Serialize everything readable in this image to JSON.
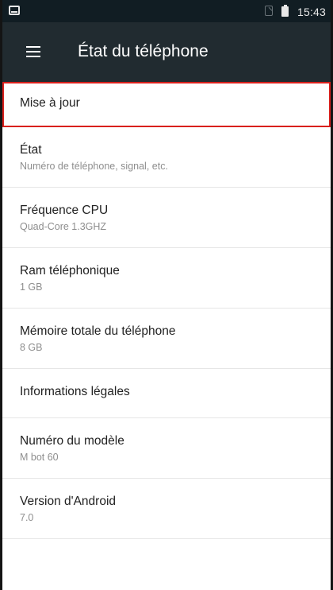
{
  "status_bar": {
    "time": "15:43",
    "icons": [
      "app-notification-icon",
      "no-sim-icon",
      "battery-icon"
    ]
  },
  "toolbar": {
    "title": "État du téléphone",
    "menu_icon": "hamburger-menu-icon"
  },
  "colors": {
    "statusbar_bg": "#111d23",
    "toolbar_bg": "#212b30",
    "highlight": "#d9201c"
  },
  "settings": [
    {
      "title": "Mise à jour"
    },
    {
      "title": "État",
      "subtitle": "Numéro de téléphone, signal, etc."
    },
    {
      "title": "Fréquence CPU",
      "subtitle": "Quad-Core 1.3GHZ"
    },
    {
      "title": "Ram téléphonique",
      "subtitle": "1 GB"
    },
    {
      "title": "Mémoire totale du téléphone",
      "subtitle": "8 GB"
    },
    {
      "title": "Informations légales"
    },
    {
      "title": "Numéro du modèle",
      "subtitle": "M bot 60"
    },
    {
      "title": "Version d'Android",
      "subtitle": "7.0"
    }
  ]
}
